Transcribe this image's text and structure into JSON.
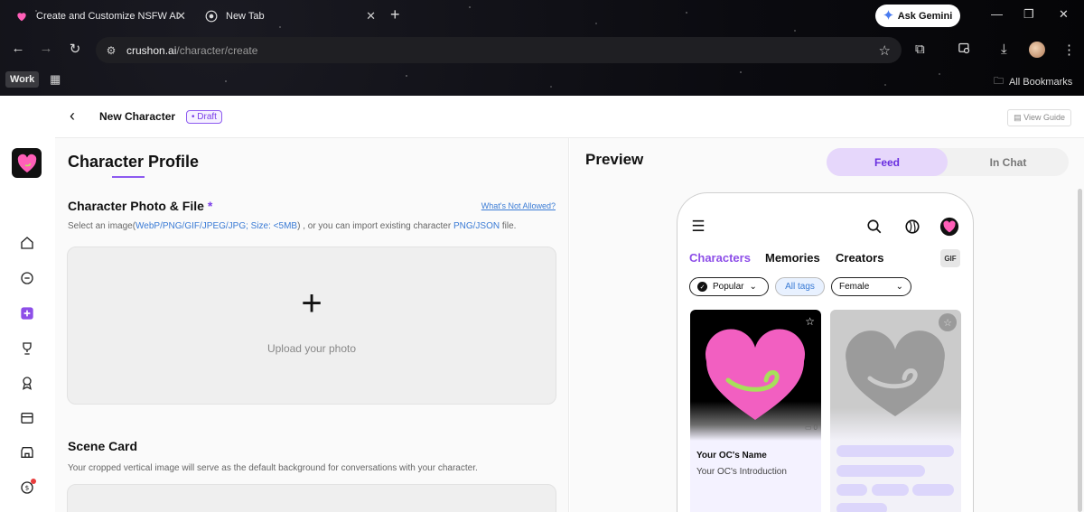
{
  "browser": {
    "tabs": [
      {
        "title": "Create and Customize NSFW AI",
        "icon": "heart-favicon"
      },
      {
        "title": "New Tab",
        "icon": "chrome-icon"
      }
    ],
    "new_tab": "+",
    "ask_gemini": "Ask Gemini",
    "url_domain": "crushon.ai",
    "url_path": "/character/create",
    "profile_chip": "Work",
    "bookmarks_label": "All Bookmarks",
    "icons": {
      "back": "←",
      "forward": "→",
      "reload": "↻",
      "star": "☆",
      "minimize": "—",
      "restore": "❐",
      "close": "✕",
      "apps": "▦",
      "extensions": "⧉",
      "download": "⤓",
      "site_info": "⚙",
      "folder": "🗀"
    }
  },
  "header": {
    "back_icon": "‹",
    "title": "New Character",
    "badge": "• Draft",
    "view_guide": "View Guide"
  },
  "sidebar": {
    "items": [
      {
        "name": "home",
        "icon": "⌂"
      },
      {
        "name": "chat",
        "icon": "◯"
      },
      {
        "name": "create",
        "icon": "✚"
      },
      {
        "name": "trophy",
        "icon": "🏆"
      },
      {
        "name": "badge",
        "icon": "◎"
      },
      {
        "name": "card",
        "icon": "▭"
      },
      {
        "name": "store",
        "icon": "⌂"
      },
      {
        "name": "coin",
        "icon": "$"
      }
    ]
  },
  "form": {
    "profile_heading": "Character Profile",
    "photo_heading": "Character Photo & File",
    "required_mark": "*",
    "not_allowed_link": "What's Not Allowed?",
    "photo_desc_pre": "Select an image(",
    "photo_desc_formats": "WebP/PNG/GIF/JPEG/JPG; Size: <5MB",
    "photo_desc_mid": ") , or you can import existing character ",
    "photo_desc_import": "PNG/JSON",
    "photo_desc_post": " file.",
    "upload_plus": "+",
    "upload_label": "Upload your photo",
    "scene_heading": "Scene Card",
    "scene_desc": "Your cropped vertical image will serve as the default background for conversations with your character."
  },
  "preview": {
    "heading": "Preview",
    "seg_feed": "Feed",
    "seg_inchat": "In Chat",
    "phone_icons": {
      "menu": "☰",
      "search": "⌕",
      "globe": "◍"
    },
    "tabs": [
      {
        "label": "Characters",
        "active": true
      },
      {
        "label": "Memories",
        "active": false
      },
      {
        "label": "Creators",
        "active": false
      }
    ],
    "gif": "GIF",
    "filters": {
      "sort": "Popular",
      "tags": "All tags",
      "gender": "Female",
      "chevron": "⌄",
      "sort_icon": "✓"
    },
    "card": {
      "name": "Your OC's Name",
      "intro": "Your OC's Introduction",
      "messages": "0",
      "star": "☆"
    }
  }
}
